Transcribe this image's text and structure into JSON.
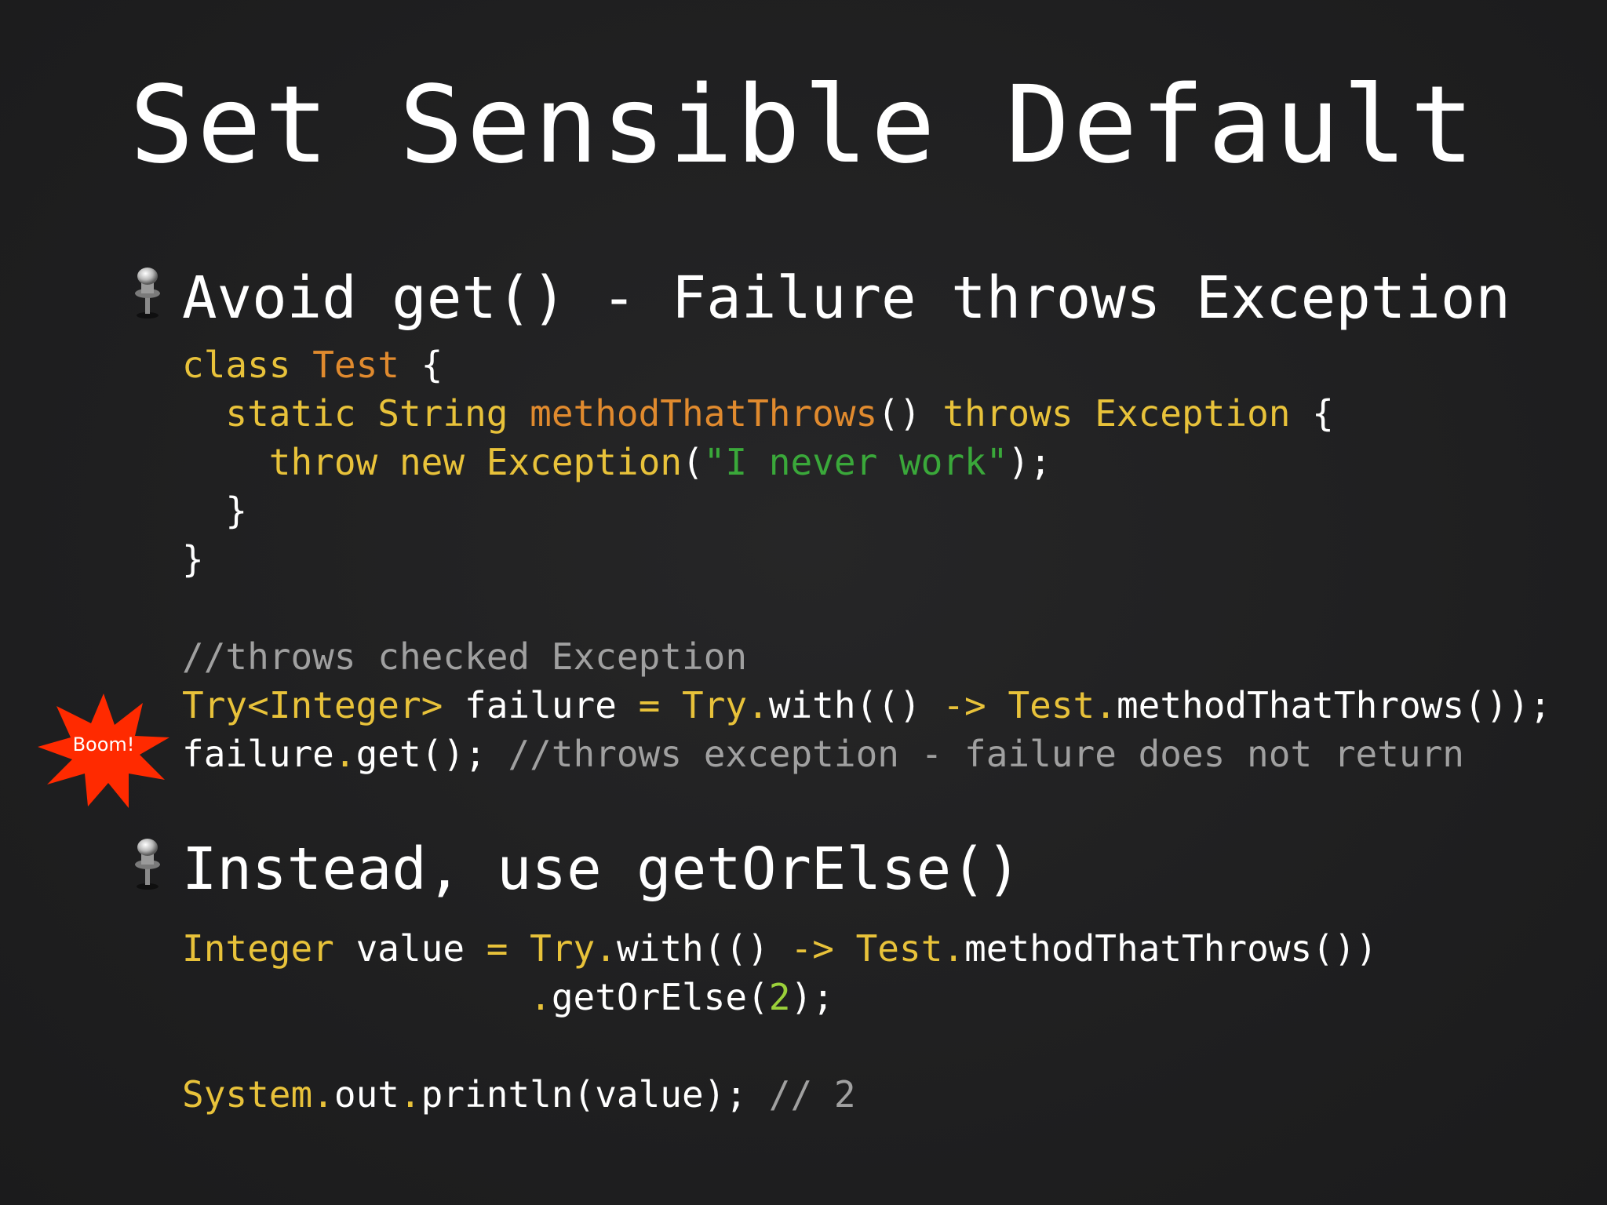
{
  "slide": {
    "title": "Set Sensible Default",
    "bullets": [
      {
        "text": "Avoid get() - Failure throws Exception",
        "icon": "pushpin-icon"
      },
      {
        "text": "Instead, use getOrElse()",
        "icon": "pushpin-icon"
      }
    ],
    "callout": {
      "label": "Boom!",
      "color": "#ff2a00"
    }
  },
  "code1": {
    "l1": [
      "class",
      " ",
      "Test",
      " {"
    ],
    "l2": [
      "  ",
      "static",
      " ",
      "String",
      " ",
      "methodThatThrows",
      "() ",
      "throws",
      " ",
      "Exception",
      " {"
    ],
    "l3": [
      "    ",
      "throw",
      " ",
      "new",
      " ",
      "Exception",
      "(",
      "\"I never work\"",
      ");"
    ],
    "l4": [
      "  }"
    ],
    "l5": [
      "}"
    ],
    "l6": [
      ""
    ],
    "l7": [
      "//throws checked Exception"
    ],
    "l8": [
      "Try<Integer>",
      " failure ",
      "=",
      " ",
      "Try",
      ".",
      "with(() ",
      "->",
      " ",
      "Test",
      ".",
      "methodThatThrows());"
    ],
    "l9": [
      "failure",
      ".",
      "get(); ",
      "//throws exception - failure does not return"
    ]
  },
  "code2": {
    "l1": [
      "Integer",
      " value ",
      "=",
      " ",
      "Try",
      ".",
      "with(() ",
      "->",
      " ",
      "Test",
      ".",
      "methodThatThrows())"
    ],
    "l2": [
      "                ",
      ".",
      "getOrElse(",
      "2",
      ");"
    ],
    "l3": [
      ""
    ],
    "l4": [
      "System",
      ".",
      "out",
      ".",
      "println(value); ",
      "// 2"
    ]
  },
  "colors": {
    "keyword": "#e8c23a",
    "class_name": "#e08a2e",
    "string": "#3aa83a",
    "comment": "#a0a0a0",
    "number": "#9bd13a",
    "background": "#1f1f20"
  }
}
